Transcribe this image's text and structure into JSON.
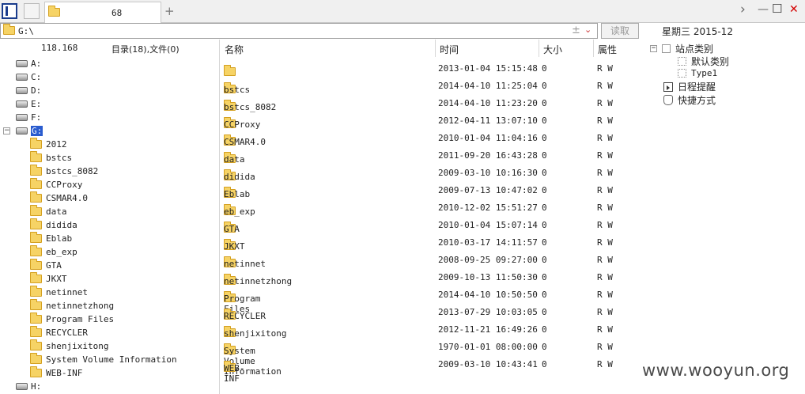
{
  "tab": {
    "label": "68"
  },
  "address": {
    "path": "G:\\",
    "read_label": "读取",
    "plus_glyph": "±"
  },
  "window": {
    "close_glyph": "✕",
    "min_glyph": "—",
    "max_glyph": "☐",
    "next_glyph": "›"
  },
  "left": {
    "ip": "118.168",
    "summary": "目录(18),文件(0)",
    "drives_before": [
      "A:",
      "C:",
      "D:",
      "E:",
      "F:"
    ],
    "selected_drive": "G:",
    "folders": [
      "2012",
      "bstcs",
      "bstcs_8082",
      "CCProxy",
      "CSMAR4.0",
      "data",
      "didida",
      "Eblab",
      "eb_exp",
      "GTA",
      "JKXT",
      "netinnet",
      "netinnetzhong",
      "Program Files",
      "RECYCLER",
      "shenjixitong",
      "System Volume Information",
      "WEB-INF"
    ],
    "drives_after": [
      "H:"
    ]
  },
  "columns": {
    "name": "名称",
    "time": "时间",
    "size": "大小",
    "attr": "属性"
  },
  "files": [
    {
      "name": "",
      "time": "2013-01-04 15:15:48",
      "size": "0",
      "attr": "R W"
    },
    {
      "name": "bstcs",
      "time": "2014-04-10 11:25:04",
      "size": "0",
      "attr": "R W"
    },
    {
      "name": "bstcs_8082",
      "time": "2014-04-10 11:23:20",
      "size": "0",
      "attr": "R W"
    },
    {
      "name": "CCProxy",
      "time": "2012-04-11 13:07:10",
      "size": "0",
      "attr": "R W"
    },
    {
      "name": "CSMAR4.0",
      "time": "2010-01-04 11:04:16",
      "size": "0",
      "attr": "R W"
    },
    {
      "name": "data",
      "time": "2011-09-20 16:43:28",
      "size": "0",
      "attr": "R W"
    },
    {
      "name": "didida",
      "time": "2009-03-10 10:16:30",
      "size": "0",
      "attr": "R W"
    },
    {
      "name": "Eblab",
      "time": "2009-07-13 10:47:02",
      "size": "0",
      "attr": "R W"
    },
    {
      "name": "eb_exp",
      "time": "2010-12-02 15:51:27",
      "size": "0",
      "attr": "R W"
    },
    {
      "name": "GTA",
      "time": "2010-01-04 15:07:14",
      "size": "0",
      "attr": "R W"
    },
    {
      "name": "JKXT",
      "time": "2010-03-17 14:11:57",
      "size": "0",
      "attr": "R W"
    },
    {
      "name": "netinnet",
      "time": "2008-09-25 09:27:00",
      "size": "0",
      "attr": "R W"
    },
    {
      "name": "netinnetzhong",
      "time": "2009-10-13 11:50:30",
      "size": "0",
      "attr": "R W"
    },
    {
      "name": "Program Files",
      "time": "2014-04-10 10:50:50",
      "size": "0",
      "attr": "R W"
    },
    {
      "name": "RECYCLER",
      "time": "2013-07-29 10:03:05",
      "size": "0",
      "attr": "R W"
    },
    {
      "name": "shenjixitong",
      "time": "2012-11-21 16:49:26",
      "size": "0",
      "attr": "R W"
    },
    {
      "name": "System Volume Information",
      "time": "1970-01-01 08:00:00",
      "size": "0",
      "attr": "R W"
    },
    {
      "name": "WEB-INF",
      "time": "2009-03-10 10:43:41",
      "size": "0",
      "attr": "R W"
    }
  ],
  "right": {
    "date_label": "星期三 2015-12",
    "tree": {
      "site_category": "站点类别",
      "default_category": "默认类别",
      "type1": "Type1",
      "schedule": "日程提醒",
      "shortcut": "快捷方式"
    }
  },
  "watermark": "www.wooyun.org",
  "colors": {
    "selection": "#2a5ccf",
    "folder": "#f6d365",
    "close": "#d40000"
  }
}
